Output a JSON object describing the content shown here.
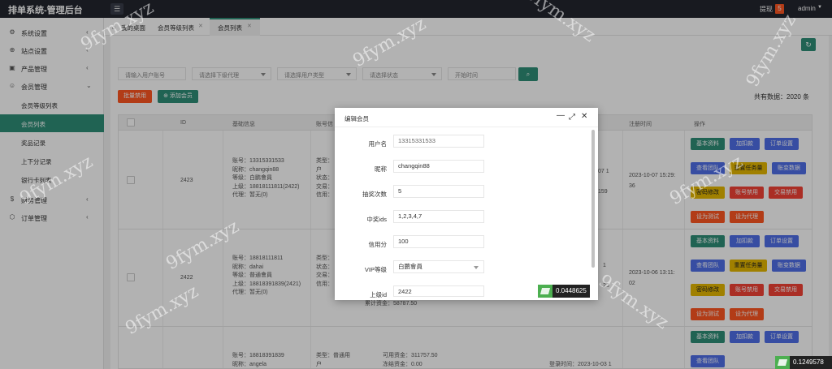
{
  "app": {
    "title": "排单系统-管理后台",
    "withdraw_label": "提现",
    "withdraw_count": "5",
    "user": "admin"
  },
  "sidebar": {
    "items": [
      {
        "label": "系统设置",
        "icon": "gear-icon"
      },
      {
        "label": "站点设置",
        "icon": "globe-icon"
      },
      {
        "label": "产品管理",
        "icon": "box-icon"
      },
      {
        "label": "会员管理",
        "icon": "user-icon"
      }
    ],
    "subitems": [
      {
        "label": "会员等级列表"
      },
      {
        "label": "会员列表"
      },
      {
        "label": "奖品记录"
      },
      {
        "label": "上下分记录"
      },
      {
        "label": "银行卡列表"
      }
    ],
    "bottom": [
      {
        "label": "财务管理",
        "icon": "dollar-icon"
      },
      {
        "label": "订单管理",
        "icon": "package-icon"
      }
    ]
  },
  "tabs": [
    {
      "label": "我的桌面"
    },
    {
      "label": "会员等级列表"
    },
    {
      "label": "会员列表"
    }
  ],
  "filters": {
    "account_placeholder": "请输入用户账号",
    "agent_placeholder": "请选择下级代理",
    "type_placeholder": "请选择用户类型",
    "status_placeholder": "请选择状态",
    "time_placeholder": "开始时间"
  },
  "toolbar": {
    "batch_disable": "批量禁用",
    "add_member": "添加会员",
    "total": "共有数据：2020 条"
  },
  "table": {
    "headers": [
      "ID",
      "基础信息",
      "账号信",
      "注册时间",
      "操作"
    ],
    "rows": [
      {
        "id": "2423",
        "info": [
          "账号：13315331533",
          "昵称：changqin88",
          "等级：白鹏會員",
          "上级：18818111811(2422)",
          "代理：暂无(0)"
        ],
        "acct": [
          "类型：",
          "户",
          "状态：",
          "交易：",
          "信用："
        ],
        "mid": [
          "07 1",
          "159"
        ],
        "reg": [
          "2023-10-07 15:29:",
          "36"
        ],
        "actions": [
          "基本资料",
          "加扣款",
          "订单设置",
          "查看团队",
          "重置任务量",
          "账变数据",
          "密码修改",
          "账号禁用",
          "交易禁用",
          "设为测试",
          "设为代理"
        ]
      },
      {
        "id": "2422",
        "info": [
          "账号：18818111811",
          "昵称：dahai",
          "等级：普通會員",
          "上级：18818391839(2421)",
          "代理：暂无(0)"
        ],
        "acct": [
          "类型：",
          "状态：",
          "交易：",
          "信用：",
          "累计资金：58787.50"
        ],
        "mid": [
          "1",
          "23"
        ],
        "reg": [
          "2023-10-06 13:11:",
          "02"
        ],
        "actions": [
          "基本资料",
          "加扣款",
          "订单设置",
          "查看团队",
          "重置任务量",
          "账变数据",
          "密码修改",
          "账号禁用",
          "交易禁用",
          "设为测试",
          "设为代理"
        ]
      },
      {
        "id": "",
        "info": [
          "账号：18818391839",
          "昵称：angela"
        ],
        "acct": [
          "类型：普通用",
          "户"
        ],
        "funds": [
          "可用资金：311757.50",
          "冻结资金：0.00"
        ],
        "mid": [
          "登录时间：2023-10-03 1"
        ],
        "actions": [
          "基本资料",
          "加扣款",
          "订单设置",
          "查看团队"
        ]
      }
    ]
  },
  "modal": {
    "title": "编辑会员",
    "fields": [
      {
        "label": "用户名",
        "value": "13315331533"
      },
      {
        "label": "昵称",
        "value": "changqin88"
      },
      {
        "label": "抽奖次数",
        "value": "5"
      },
      {
        "label": "中奖ids",
        "value": "1,2,3,4,7"
      },
      {
        "label": "信用分",
        "value": "100"
      },
      {
        "label": "VIP等级",
        "value": "白鹏會員"
      },
      {
        "label": "上级id",
        "value": "2422"
      }
    ]
  },
  "speed": {
    "modal": "0.0448625",
    "corner": "0.1249578"
  },
  "watermark": "9fym.xyz"
}
